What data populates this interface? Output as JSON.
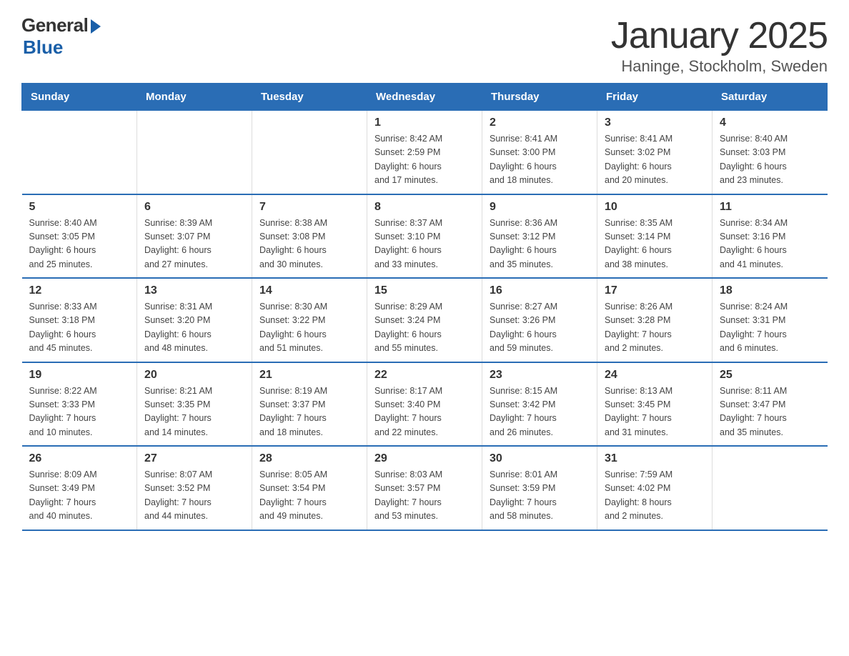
{
  "header": {
    "logo_general": "General",
    "logo_blue": "Blue",
    "title": "January 2025",
    "subtitle": "Haninge, Stockholm, Sweden"
  },
  "days_of_week": [
    "Sunday",
    "Monday",
    "Tuesday",
    "Wednesday",
    "Thursday",
    "Friday",
    "Saturday"
  ],
  "weeks": [
    [
      {
        "day": "",
        "info": ""
      },
      {
        "day": "",
        "info": ""
      },
      {
        "day": "",
        "info": ""
      },
      {
        "day": "1",
        "info": "Sunrise: 8:42 AM\nSunset: 2:59 PM\nDaylight: 6 hours\nand 17 minutes."
      },
      {
        "day": "2",
        "info": "Sunrise: 8:41 AM\nSunset: 3:00 PM\nDaylight: 6 hours\nand 18 minutes."
      },
      {
        "day": "3",
        "info": "Sunrise: 8:41 AM\nSunset: 3:02 PM\nDaylight: 6 hours\nand 20 minutes."
      },
      {
        "day": "4",
        "info": "Sunrise: 8:40 AM\nSunset: 3:03 PM\nDaylight: 6 hours\nand 23 minutes."
      }
    ],
    [
      {
        "day": "5",
        "info": "Sunrise: 8:40 AM\nSunset: 3:05 PM\nDaylight: 6 hours\nand 25 minutes."
      },
      {
        "day": "6",
        "info": "Sunrise: 8:39 AM\nSunset: 3:07 PM\nDaylight: 6 hours\nand 27 minutes."
      },
      {
        "day": "7",
        "info": "Sunrise: 8:38 AM\nSunset: 3:08 PM\nDaylight: 6 hours\nand 30 minutes."
      },
      {
        "day": "8",
        "info": "Sunrise: 8:37 AM\nSunset: 3:10 PM\nDaylight: 6 hours\nand 33 minutes."
      },
      {
        "day": "9",
        "info": "Sunrise: 8:36 AM\nSunset: 3:12 PM\nDaylight: 6 hours\nand 35 minutes."
      },
      {
        "day": "10",
        "info": "Sunrise: 8:35 AM\nSunset: 3:14 PM\nDaylight: 6 hours\nand 38 minutes."
      },
      {
        "day": "11",
        "info": "Sunrise: 8:34 AM\nSunset: 3:16 PM\nDaylight: 6 hours\nand 41 minutes."
      }
    ],
    [
      {
        "day": "12",
        "info": "Sunrise: 8:33 AM\nSunset: 3:18 PM\nDaylight: 6 hours\nand 45 minutes."
      },
      {
        "day": "13",
        "info": "Sunrise: 8:31 AM\nSunset: 3:20 PM\nDaylight: 6 hours\nand 48 minutes."
      },
      {
        "day": "14",
        "info": "Sunrise: 8:30 AM\nSunset: 3:22 PM\nDaylight: 6 hours\nand 51 minutes."
      },
      {
        "day": "15",
        "info": "Sunrise: 8:29 AM\nSunset: 3:24 PM\nDaylight: 6 hours\nand 55 minutes."
      },
      {
        "day": "16",
        "info": "Sunrise: 8:27 AM\nSunset: 3:26 PM\nDaylight: 6 hours\nand 59 minutes."
      },
      {
        "day": "17",
        "info": "Sunrise: 8:26 AM\nSunset: 3:28 PM\nDaylight: 7 hours\nand 2 minutes."
      },
      {
        "day": "18",
        "info": "Sunrise: 8:24 AM\nSunset: 3:31 PM\nDaylight: 7 hours\nand 6 minutes."
      }
    ],
    [
      {
        "day": "19",
        "info": "Sunrise: 8:22 AM\nSunset: 3:33 PM\nDaylight: 7 hours\nand 10 minutes."
      },
      {
        "day": "20",
        "info": "Sunrise: 8:21 AM\nSunset: 3:35 PM\nDaylight: 7 hours\nand 14 minutes."
      },
      {
        "day": "21",
        "info": "Sunrise: 8:19 AM\nSunset: 3:37 PM\nDaylight: 7 hours\nand 18 minutes."
      },
      {
        "day": "22",
        "info": "Sunrise: 8:17 AM\nSunset: 3:40 PM\nDaylight: 7 hours\nand 22 minutes."
      },
      {
        "day": "23",
        "info": "Sunrise: 8:15 AM\nSunset: 3:42 PM\nDaylight: 7 hours\nand 26 minutes."
      },
      {
        "day": "24",
        "info": "Sunrise: 8:13 AM\nSunset: 3:45 PM\nDaylight: 7 hours\nand 31 minutes."
      },
      {
        "day": "25",
        "info": "Sunrise: 8:11 AM\nSunset: 3:47 PM\nDaylight: 7 hours\nand 35 minutes."
      }
    ],
    [
      {
        "day": "26",
        "info": "Sunrise: 8:09 AM\nSunset: 3:49 PM\nDaylight: 7 hours\nand 40 minutes."
      },
      {
        "day": "27",
        "info": "Sunrise: 8:07 AM\nSunset: 3:52 PM\nDaylight: 7 hours\nand 44 minutes."
      },
      {
        "day": "28",
        "info": "Sunrise: 8:05 AM\nSunset: 3:54 PM\nDaylight: 7 hours\nand 49 minutes."
      },
      {
        "day": "29",
        "info": "Sunrise: 8:03 AM\nSunset: 3:57 PM\nDaylight: 7 hours\nand 53 minutes."
      },
      {
        "day": "30",
        "info": "Sunrise: 8:01 AM\nSunset: 3:59 PM\nDaylight: 7 hours\nand 58 minutes."
      },
      {
        "day": "31",
        "info": "Sunrise: 7:59 AM\nSunset: 4:02 PM\nDaylight: 8 hours\nand 2 minutes."
      },
      {
        "day": "",
        "info": ""
      }
    ]
  ]
}
